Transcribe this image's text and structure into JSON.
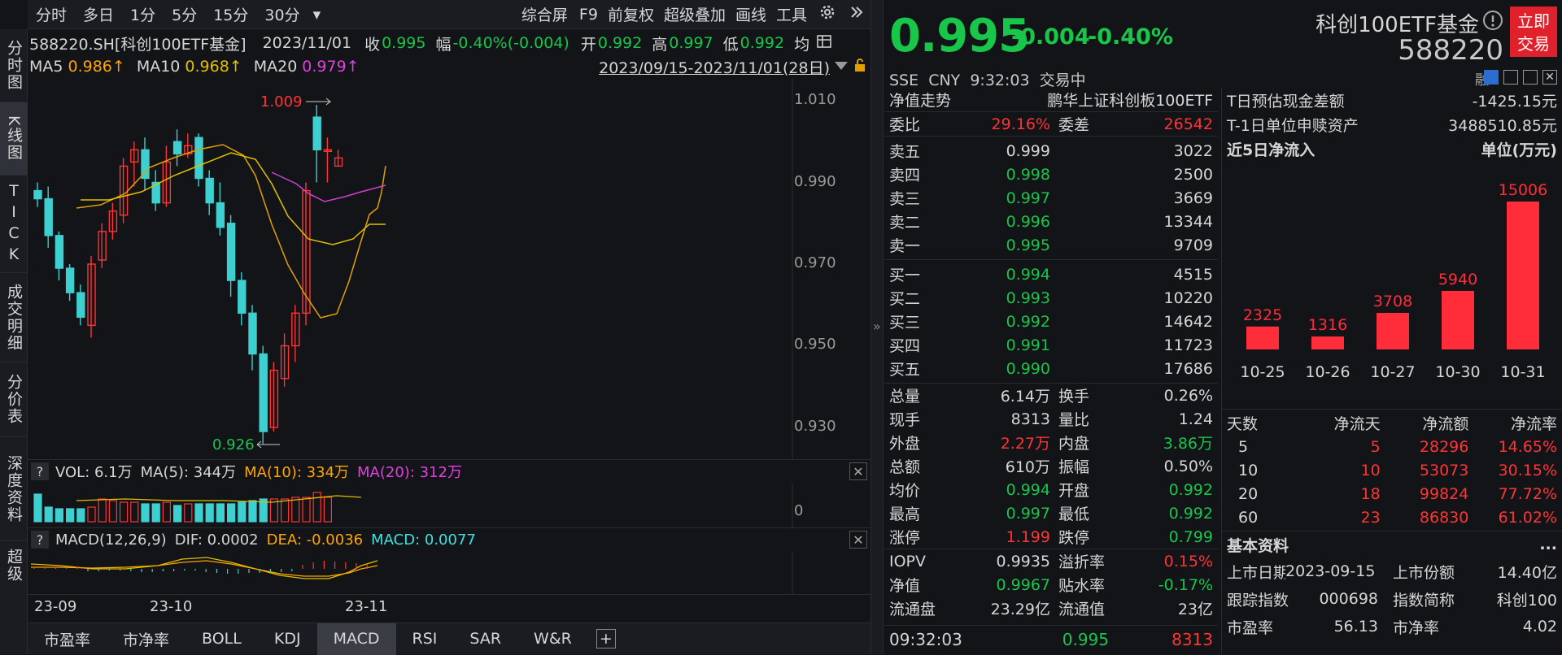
{
  "top": {
    "tabs": [
      "分时",
      "多日",
      "1分",
      "5分",
      "15分",
      "30分"
    ],
    "dropdown": "▾",
    "tools": [
      "综合屏",
      "F9",
      "前复权",
      "超级叠加",
      "画线",
      "工具"
    ]
  },
  "side": {
    "items": [
      "分时图",
      "K线图",
      "TICK",
      "成交明细",
      "分价表",
      "深度资料",
      "超级"
    ]
  },
  "info": {
    "code": "588220.SH[科创100ETF基金]",
    "date": "2023/11/01",
    "close_label": "收",
    "close": "0.995",
    "amp_label": "幅",
    "amp": "-0.40%(-0.004)",
    "open_label": "开",
    "open": "0.992",
    "high_label": "高",
    "high": "0.997",
    "low_label": "低",
    "low": "0.992",
    "avg_label": "均"
  },
  "ma": {
    "ma5": "MA5",
    "ma5v": "0.986↑",
    "ma10": "MA10",
    "ma10v": "0.968↑",
    "ma20": "MA20",
    "ma20v": "0.979↑",
    "range": "2023/09/15-2023/11/01(28日)"
  },
  "price_axis": {
    "labels": [
      "1.010",
      "0.990",
      "0.970",
      "0.950",
      "0.930"
    ],
    "high_mark": "1.009",
    "low_mark": "0.926"
  },
  "vol": {
    "q": "?",
    "vol": "VOL: 6.1万",
    "ma5": "MA(5): 344万",
    "ma10": "MA(10): 334万",
    "ma20": "MA(20): 312万",
    "axis": "0"
  },
  "macd": {
    "q": "?",
    "title": "MACD(12,26,9)",
    "dif": "DIF: 0.0002",
    "dea": "DEA: -0.0036",
    "macd": "MACD: 0.0077"
  },
  "dates": [
    "23-09",
    "23-10",
    "23-11"
  ],
  "bottom_tabs": [
    "市盈率",
    "市净率",
    "BOLL",
    "KDJ",
    "MACD",
    "RSI",
    "SAR",
    "W&R",
    "+"
  ],
  "quote": {
    "price": "0.995",
    "change": "-0.004",
    "pct": "-0.40%",
    "name": "科创100ETF基金",
    "code": "588220",
    "trade_btn": "立即交易",
    "exch": "SSE",
    "cur": "CNY",
    "time": "9:32:03",
    "status": "交易中",
    "rong": "融"
  },
  "nav": {
    "label": "净值走势",
    "fund": "鹏华上证科创板100ETF"
  },
  "weibi": {
    "wb_label": "委比",
    "wb": "29.16%",
    "wc_label": "委差",
    "wc": "26542"
  },
  "asks": [
    {
      "l": "卖五",
      "p": "0.999",
      "v": "3022"
    },
    {
      "l": "卖四",
      "p": "0.998",
      "v": "2500"
    },
    {
      "l": "卖三",
      "p": "0.997",
      "v": "3669"
    },
    {
      "l": "卖二",
      "p": "0.996",
      "v": "13344"
    },
    {
      "l": "卖一",
      "p": "0.995",
      "v": "9709"
    }
  ],
  "bids": [
    {
      "l": "买一",
      "p": "0.994",
      "v": "4515"
    },
    {
      "l": "买二",
      "p": "0.993",
      "v": "10220"
    },
    {
      "l": "买三",
      "p": "0.992",
      "v": "14642"
    },
    {
      "l": "买四",
      "p": "0.991",
      "v": "11723"
    },
    {
      "l": "买五",
      "p": "0.990",
      "v": "17686"
    }
  ],
  "stats": [
    {
      "a": "总量",
      "av": "6.14万",
      "b": "换手",
      "bv": "0.26%"
    },
    {
      "a": "现手",
      "av": "8313",
      "b": "量比",
      "bv": "1.24"
    },
    {
      "a": "外盘",
      "av": "2.27万",
      "b": "内盘",
      "bv": "3.86万"
    },
    {
      "a": "总额",
      "av": "610万",
      "b": "振幅",
      "bv": "0.50%"
    },
    {
      "a": "均价",
      "av": "0.994",
      "b": "开盘",
      "bv": "0.992"
    },
    {
      "a": "最高",
      "av": "0.997",
      "b": "最低",
      "bv": "0.992"
    },
    {
      "a": "涨停",
      "av": "1.199",
      "b": "跌停",
      "bv": "0.799"
    }
  ],
  "stats2": [
    {
      "a": "IOPV",
      "av": "0.9935",
      "b": "溢折率",
      "bv": "0.15%"
    },
    {
      "a": "净值",
      "av": "0.9967",
      "b": "贴水率",
      "bv": "-0.17%"
    },
    {
      "a": "流通盘",
      "av": "23.29亿",
      "b": "流通值",
      "bv": "23亿"
    }
  ],
  "last_trade": {
    "time": "09:32:03",
    "price": "0.995",
    "vol": "8313"
  },
  "fundinfo": {
    "cash_label": "T日预估现金差额",
    "cash": "-1425.15元",
    "asset_label": "T-1日单位申赎资产",
    "asset": "3488510.85元",
    "flow_title": "近5日净流入",
    "unit": "单位(万元)"
  },
  "chart_data": {
    "type": "bar",
    "categories": [
      "10-25",
      "10-26",
      "10-27",
      "10-30",
      "10-31"
    ],
    "values": [
      2325,
      1316,
      3708,
      5940,
      15006
    ],
    "title": "近5日净流入",
    "ylabel": "单位(万元)",
    "ylim": [
      0,
      15006
    ],
    "color": "#ff2d3a"
  },
  "flowtable": {
    "headers": [
      "天数",
      "净流天",
      "净流额",
      "净流率"
    ],
    "rows": [
      [
        "5",
        "5",
        "28296",
        "14.65%"
      ],
      [
        "10",
        "10",
        "53073",
        "30.15%"
      ],
      [
        "20",
        "18",
        "99824",
        "77.72%"
      ],
      [
        "60",
        "23",
        "86830",
        "61.02%"
      ]
    ]
  },
  "basic": {
    "title": "基本资料",
    "more": "...",
    "r1a": "上市日期",
    "r1av": "2023-09-15",
    "r1b": "上市份额",
    "r1bv": "14.40亿",
    "r2a": "跟踪指数",
    "r2av": "000698",
    "r2b": "指数简称",
    "r2bv": "科创100",
    "r3a": "市盈率",
    "r3av": "56.13",
    "r3b": "市净率",
    "r3bv": "4.02"
  }
}
